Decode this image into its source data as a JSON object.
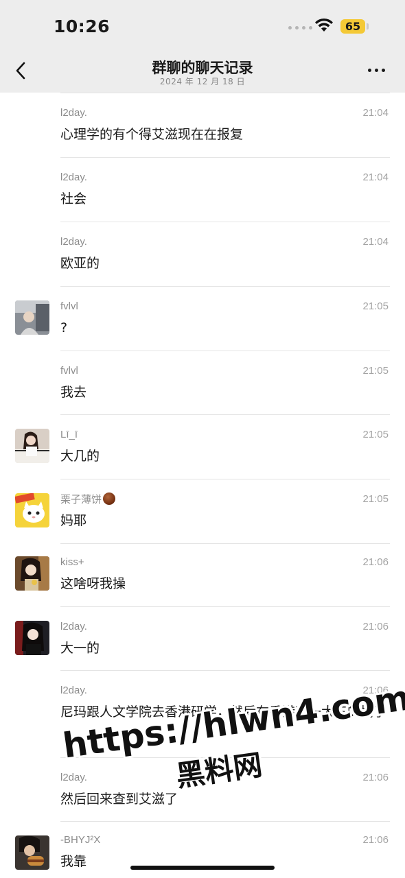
{
  "status_bar": {
    "time": "10:26",
    "battery": "65"
  },
  "header": {
    "title": "群聊的聊天记录",
    "subtitle": "2024 年 12 月 18 日"
  },
  "messages": [
    {
      "sender": "l2day.",
      "time": "21:04",
      "text": "心理学的有个得艾滋现在在报复",
      "avatar": "none"
    },
    {
      "sender": "l2day.",
      "time": "21:04",
      "text": "社会",
      "avatar": "none"
    },
    {
      "sender": "l2day.",
      "time": "21:04",
      "text": "欧亚的",
      "avatar": "none"
    },
    {
      "sender": "fvlvl",
      "time": "21:05",
      "text": "?",
      "avatar": "photo-person-car"
    },
    {
      "sender": "fvlvl",
      "time": "21:05",
      "text": "我去",
      "avatar": "none"
    },
    {
      "sender": "Lī_ī",
      "time": "21:05",
      "text": "大几的",
      "avatar": "photo-girl-piano"
    },
    {
      "sender": "栗子薄饼",
      "time": "21:05",
      "text": "妈耶",
      "avatar": "cartoon-cat-yellow",
      "sender_emoji": "chestnut"
    },
    {
      "sender": "kiss+",
      "time": "21:06",
      "text": "这啥呀我操",
      "avatar": "photo-girl-selfie"
    },
    {
      "sender": "l2day.",
      "time": "21:06",
      "text": "大一的",
      "avatar": "photo-girl-dark"
    },
    {
      "sender": "l2day.",
      "time": "21:06",
      "text": "尼玛跟人文学院去香港研学，然后在香港和一大三的搞了",
      "avatar": "none"
    },
    {
      "sender": "l2day.",
      "time": "21:06",
      "text": "然后回来查到艾滋了",
      "avatar": "none"
    },
    {
      "sender": "-BHYJ²X",
      "time": "21:06",
      "text": "我靠",
      "avatar": "photo-person-eating"
    }
  ],
  "watermark": {
    "url": "https://hlwn4.com",
    "name": "黑料网"
  },
  "colors": {
    "header_bg": "#ededed",
    "battery": "#f4c936",
    "divider": "#e4e4e4"
  }
}
